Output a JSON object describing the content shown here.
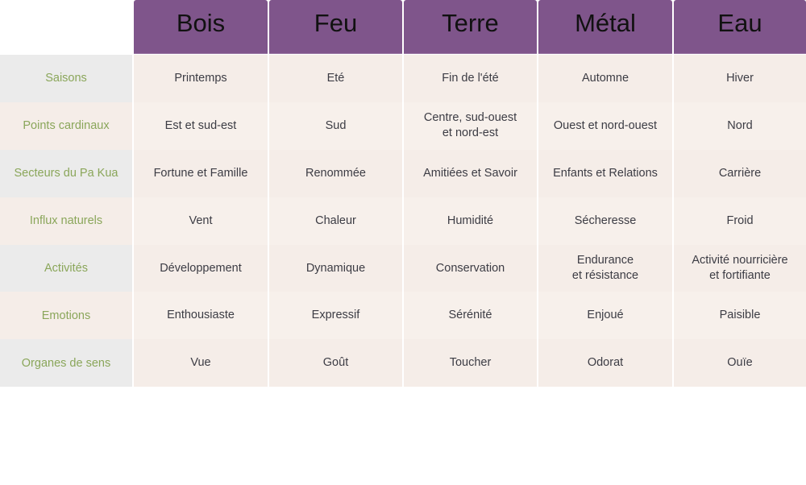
{
  "table": {
    "columns": [
      "Bois",
      "Feu",
      "Terre",
      "Métal",
      "Eau"
    ],
    "rows": [
      {
        "label": "Saisons",
        "cells": [
          "Printemps",
          "Eté",
          "Fin de l'été",
          "Automne",
          "Hiver"
        ]
      },
      {
        "label": "Points cardinaux",
        "cells": [
          "Est et sud-est",
          "Sud",
          "Centre, sud-ouest\net nord-est",
          "Ouest et nord-ouest",
          "Nord"
        ]
      },
      {
        "label": "Secteurs du Pa Kua",
        "cells": [
          "Fortune et Famille",
          "Renommée",
          "Amitiées et Savoir",
          "Enfants et Relations",
          "Carrière"
        ]
      },
      {
        "label": "Influx naturels",
        "cells": [
          "Vent",
          "Chaleur",
          "Humidité",
          "Sécheresse",
          "Froid"
        ]
      },
      {
        "label": "Activités",
        "cells": [
          "Développement",
          "Dynamique",
          "Conservation",
          "Endurance\net résistance",
          "Activité nourricière\net fortifiante"
        ]
      },
      {
        "label": "Emotions",
        "cells": [
          "Enthousiaste",
          "Expressif",
          "Sérénité",
          "Enjoué",
          "Paisible"
        ]
      },
      {
        "label": "Organes de sens",
        "cells": [
          "Vue",
          "Goût",
          "Toucher",
          "Odorat",
          "Ouïe"
        ]
      }
    ]
  },
  "colors": {
    "header_bg": "#7f558b",
    "row_label_text": "#8aa65a",
    "cell_text": "#3c3c44",
    "label_bg_grey": "#ebebeb",
    "label_bg_beige": "#f5ede8",
    "cell_bg": "#f6eee9"
  }
}
